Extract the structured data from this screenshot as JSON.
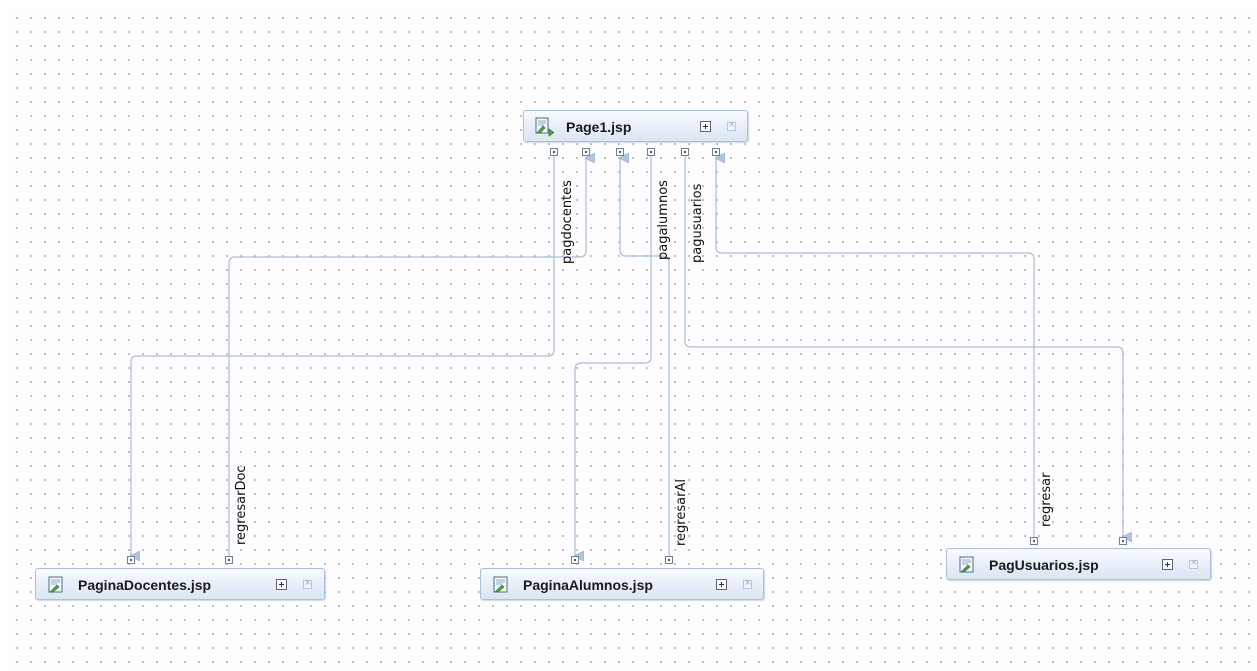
{
  "pages": {
    "page1": "Page1.jsp",
    "docentes": "PaginaDocentes.jsp",
    "alumnos": "PaginaAlumnos.jsp",
    "usuarios": "PagUsuarios.jsp"
  },
  "cases": {
    "pagdocentes": "pagdocentes",
    "pagalumnos": "pagalumnos",
    "pagusuarios": "pagusuarios",
    "regresarDoc": "regresarDoc",
    "regresarAl": "regresarAl",
    "regresar": "regresar"
  },
  "colors": {
    "edge": "#a8bddb",
    "node_border": "#a9c1dc"
  }
}
